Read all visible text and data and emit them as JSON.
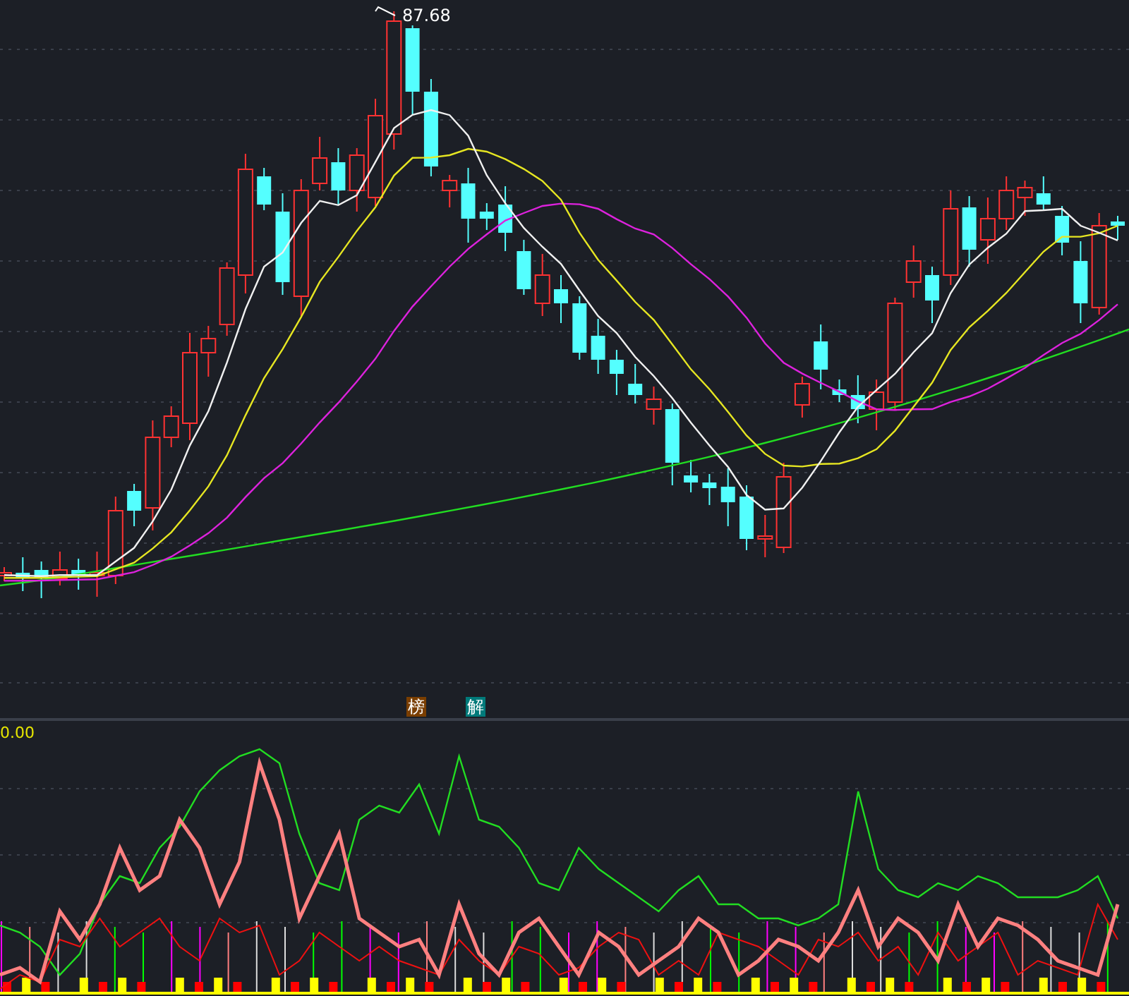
{
  "price_panel": {
    "high_label": "87.68",
    "badges": [
      {
        "label": "榜",
        "kind": "rank"
      },
      {
        "label": "解",
        "kind": "explain"
      }
    ]
  },
  "indicator_panel": {
    "value_label": "0.00"
  }
}
